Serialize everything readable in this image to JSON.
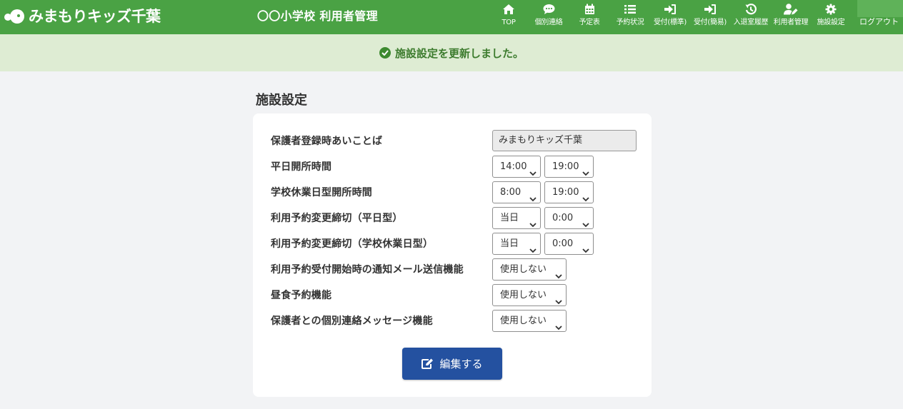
{
  "header": {
    "logo_text": "みまもりキッズ千葉",
    "app_title": "〇〇小学校 利用者管理",
    "brand_color": "#4aa244",
    "nav": [
      {
        "label": "TOP",
        "icon": "home-icon"
      },
      {
        "label": "個別連絡",
        "icon": "chat-icon"
      },
      {
        "label": "予定表",
        "icon": "calendar-icon"
      },
      {
        "label": "予約状況",
        "icon": "list-icon"
      },
      {
        "label": "受付(標準)",
        "icon": "sign-in-icon"
      },
      {
        "label": "受付(簡易)",
        "icon": "sign-in-icon"
      },
      {
        "label": "入退室履歴",
        "icon": "history-icon"
      },
      {
        "label": "利用者管理",
        "icon": "user-edit-icon"
      },
      {
        "label": "施設設定",
        "icon": "gear-icon"
      }
    ],
    "logout_label": "ログアウト"
  },
  "alert": {
    "message": "施設設定を更新しました。",
    "icon": "check-circle-icon"
  },
  "page_title": "施設設定",
  "form": {
    "rows": [
      {
        "label": "保護者登録時あいことば",
        "value": "みまもりキッズ千葉"
      },
      {
        "label": "平日開所時間",
        "value1": "14:00",
        "value2": "19:00"
      },
      {
        "label": "学校休業日型開所時間",
        "value1": "8:00",
        "value2": "19:00"
      },
      {
        "label": "利用予約変更締切（平日型）",
        "value1": "当日",
        "value2": "0:00"
      },
      {
        "label": "利用予約変更締切（学校休業日型）",
        "value1": "当日",
        "value2": "0:00"
      },
      {
        "label": "利用予約受付開始時の通知メール送信機能",
        "value": "使用しない"
      },
      {
        "label": "昼食予約機能",
        "value": "使用しない"
      },
      {
        "label": "保護者との個別連絡メッセージ機能",
        "value": "使用しない"
      }
    ],
    "edit_button_label": "編集する",
    "edit_button_color": "#2451a0"
  }
}
